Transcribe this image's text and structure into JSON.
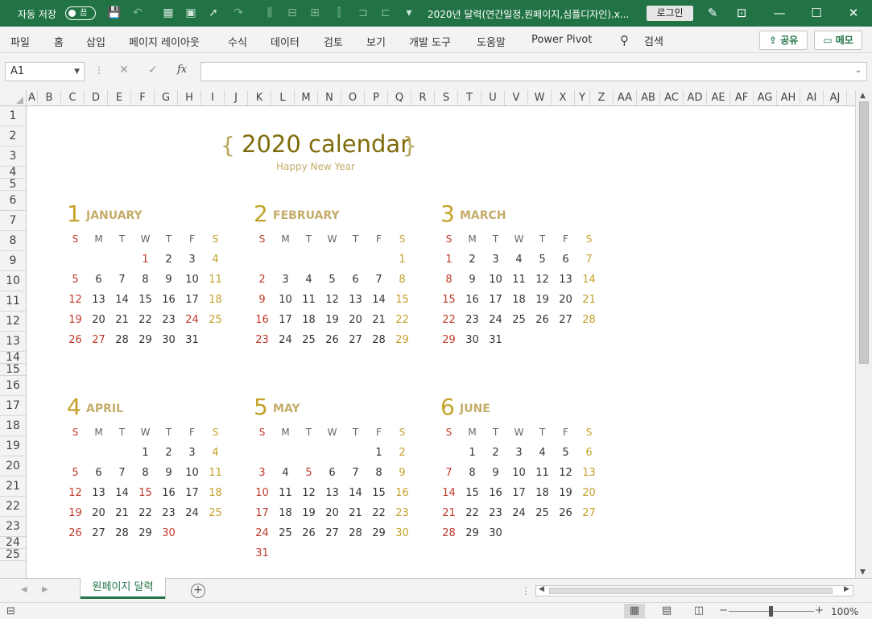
{
  "titlebar": {
    "autosave_label": "자동 저장",
    "toggle_state": "끔",
    "document_title": "2020년 달력(연간일정,원페이지,심플디자인).x...",
    "login_label": "로그인"
  },
  "ribbon": {
    "tabs": [
      "파일",
      "홈",
      "삽입",
      "페이지 레이아웃",
      "수식",
      "데이터",
      "검토",
      "보기",
      "개발 도구",
      "도움말",
      "Power Pivot"
    ],
    "search_label": "검색",
    "share_label": "공유",
    "memo_label": "메모"
  },
  "formula_bar": {
    "name_box": "A1",
    "fx_label": "fx",
    "formula": ""
  },
  "grid": {
    "columns": [
      "A",
      "B",
      "C",
      "D",
      "E",
      "F",
      "G",
      "H",
      "I",
      "J",
      "K",
      "L",
      "M",
      "N",
      "O",
      "P",
      "Q",
      "R",
      "S",
      "T",
      "U",
      "V",
      "W",
      "X",
      "Y",
      "Z",
      "AA",
      "AB",
      "AC",
      "AD",
      "AE",
      "AF",
      "AG",
      "AH",
      "AI",
      "AJ"
    ],
    "rows": [
      "1",
      "2",
      "3",
      "4",
      "5",
      "6",
      "7",
      "8",
      "9",
      "10",
      "11",
      "12",
      "13",
      "14",
      "15",
      "16",
      "17",
      "18",
      "19",
      "20",
      "21",
      "22",
      "23",
      "24",
      "25"
    ]
  },
  "calendar": {
    "title": "2020 calendar",
    "open_brace": "{",
    "close_brace": "}",
    "subtitle": "Happy New Year",
    "weekdays": [
      "S",
      "M",
      "T",
      "W",
      "T",
      "F",
      "S"
    ],
    "months": [
      {
        "num": "1",
        "name": "JANUARY",
        "weeks": [
          [
            "",
            "",
            "",
            "1",
            "2",
            "3",
            "4"
          ],
          [
            "5",
            "6",
            "7",
            "8",
            "9",
            "10",
            "11"
          ],
          [
            "12",
            "13",
            "14",
            "15",
            "16",
            "17",
            "18"
          ],
          [
            "19",
            "20",
            "21",
            "22",
            "23",
            "24",
            "25"
          ],
          [
            "26",
            "27",
            "28",
            "29",
            "30",
            "31",
            ""
          ]
        ],
        "holidays": [
          "1",
          "24",
          "27"
        ]
      },
      {
        "num": "2",
        "name": "FEBRUARY",
        "weeks": [
          [
            "",
            "",
            "",
            "",
            "",
            "",
            "1"
          ],
          [
            "2",
            "3",
            "4",
            "5",
            "6",
            "7",
            "8"
          ],
          [
            "9",
            "10",
            "11",
            "12",
            "13",
            "14",
            "15"
          ],
          [
            "16",
            "17",
            "18",
            "19",
            "20",
            "21",
            "22"
          ],
          [
            "23",
            "24",
            "25",
            "26",
            "27",
            "28",
            "29"
          ]
        ],
        "holidays": []
      },
      {
        "num": "3",
        "name": "MARCH",
        "weeks": [
          [
            "1",
            "2",
            "3",
            "4",
            "5",
            "6",
            "7"
          ],
          [
            "8",
            "9",
            "10",
            "11",
            "12",
            "13",
            "14"
          ],
          [
            "15",
            "16",
            "17",
            "18",
            "19",
            "20",
            "21"
          ],
          [
            "22",
            "23",
            "24",
            "25",
            "26",
            "27",
            "28"
          ],
          [
            "29",
            "30",
            "31",
            "",
            "",
            "",
            ""
          ]
        ],
        "holidays": [
          "1"
        ]
      },
      {
        "num": "4",
        "name": "APRIL",
        "weeks": [
          [
            "",
            "",
            "",
            "1",
            "2",
            "3",
            "4"
          ],
          [
            "5",
            "6",
            "7",
            "8",
            "9",
            "10",
            "11"
          ],
          [
            "12",
            "13",
            "14",
            "15",
            "16",
            "17",
            "18"
          ],
          [
            "19",
            "20",
            "21",
            "22",
            "23",
            "24",
            "25"
          ],
          [
            "26",
            "27",
            "28",
            "29",
            "30",
            "",
            ""
          ]
        ],
        "holidays": [
          "15",
          "30"
        ]
      },
      {
        "num": "5",
        "name": "MAY",
        "weeks": [
          [
            "",
            "",
            "",
            "",
            "",
            "1",
            "2"
          ],
          [
            "3",
            "4",
            "5",
            "6",
            "7",
            "8",
            "9"
          ],
          [
            "10",
            "11",
            "12",
            "13",
            "14",
            "15",
            "16"
          ],
          [
            "17",
            "18",
            "19",
            "20",
            "21",
            "22",
            "23"
          ],
          [
            "24",
            "25",
            "26",
            "27",
            "28",
            "29",
            "30"
          ],
          [
            "31",
            "",
            "",
            "",
            "",
            "",
            ""
          ]
        ],
        "holidays": [
          "5"
        ]
      },
      {
        "num": "6",
        "name": "JUNE",
        "weeks": [
          [
            "",
            "1",
            "2",
            "3",
            "4",
            "5",
            "6"
          ],
          [
            "7",
            "8",
            "9",
            "10",
            "11",
            "12",
            "13"
          ],
          [
            "14",
            "15",
            "16",
            "17",
            "18",
            "19",
            "20"
          ],
          [
            "21",
            "22",
            "23",
            "24",
            "25",
            "26",
            "27"
          ],
          [
            "28",
            "29",
            "30",
            "",
            "",
            "",
            ""
          ]
        ],
        "holidays": []
      }
    ]
  },
  "sheet_tabs": {
    "active": "원페이지 달력"
  },
  "status": {
    "zoom": "100%"
  },
  "colors": {
    "excel_green": "#217346",
    "sunday_red": "#c0392b",
    "saturday_gold": "#c4a12a",
    "title_olive": "#7f6c0b"
  }
}
